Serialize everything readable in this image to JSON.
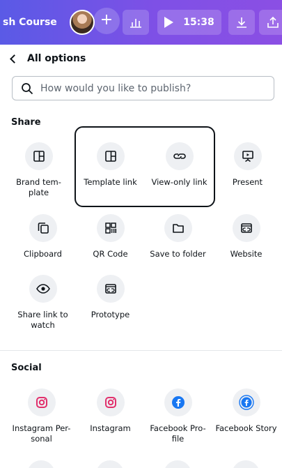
{
  "topbar": {
    "course_title": "sh Course",
    "plus_label": "+",
    "timer": "15:38"
  },
  "panel": {
    "back_title": "All options",
    "search": {
      "placeholder": "How would you like to publish?",
      "value": ""
    },
    "share_section": {
      "title": "Share",
      "items": [
        {
          "label": "Brand tem-\nplate",
          "icon": "brand-template-icon"
        },
        {
          "label": "Template link",
          "icon": "template-link-icon"
        },
        {
          "label": "View-only link",
          "icon": "link-icon"
        },
        {
          "label": "Present",
          "icon": "present-icon"
        },
        {
          "label": "Clipboard",
          "icon": "clipboard-icon"
        },
        {
          "label": "QR Code",
          "icon": "qr-code-icon"
        },
        {
          "label": "Save to folder",
          "icon": "folder-icon"
        },
        {
          "label": "Website",
          "icon": "website-icon"
        },
        {
          "label": "Share link to\nwatch",
          "icon": "eye-icon"
        },
        {
          "label": "Prototype",
          "icon": "prototype-icon"
        }
      ]
    },
    "social_section": {
      "title": "Social",
      "items": [
        {
          "label": "Instagram Per-\nsonal",
          "icon": "instagram-icon"
        },
        {
          "label": "Instagram",
          "icon": "instagram-icon"
        },
        {
          "label": "Facebook Pro-\nfile",
          "icon": "facebook-icon"
        },
        {
          "label": "Facebook Story",
          "icon": "facebook-story-icon"
        }
      ]
    }
  },
  "colors": {
    "topbar_start": "#5a5ae6",
    "topbar_end": "#8b4fe4",
    "icon_bg": "#eef0f3",
    "instagram": "#e1306c",
    "facebook": "#1877f2"
  }
}
